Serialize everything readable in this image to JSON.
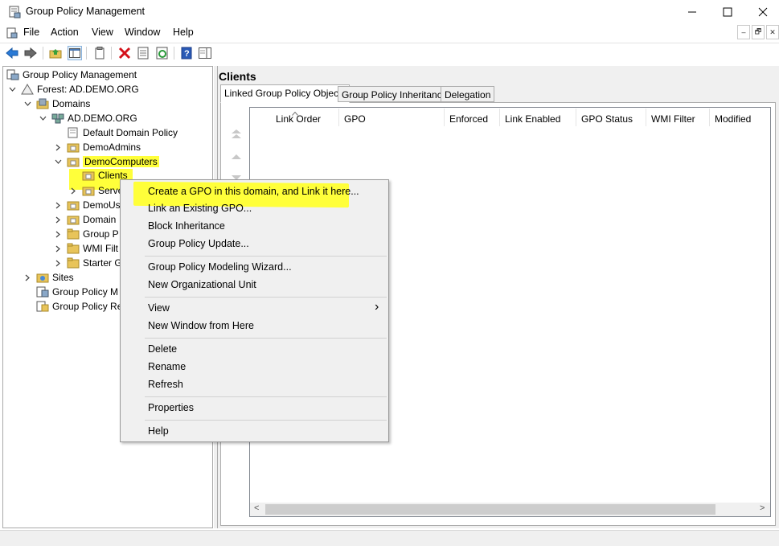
{
  "window": {
    "title": "Group Policy Management",
    "minimize": "—",
    "maximize": "☐",
    "close": "✕"
  },
  "menubar": {
    "items": [
      "File",
      "Action",
      "View",
      "Window",
      "Help"
    ],
    "mdi_min": "–",
    "mdi_restore": "🗗",
    "mdi_close": "✕"
  },
  "tree": {
    "root": "Group Policy Management",
    "forest": "Forest: AD.DEMO.ORG",
    "domains": "Domains",
    "domain": "AD.DEMO.ORG",
    "default_policy": "Default Domain Policy",
    "demoadmins": "DemoAdmins",
    "democomputers": "DemoComputers",
    "clients": "Clients",
    "servers": "Serve",
    "demousers": "DemoUs",
    "domain_controllers": "Domain",
    "group_policy_objects": "Group P",
    "wmi_filters": "WMI Filt",
    "starter_gpos": "Starter G",
    "sites": "Sites",
    "gp_modeling": "Group Policy M",
    "gp_results": "Group Policy Re"
  },
  "details": {
    "title": "Clients",
    "tabs": [
      "Linked Group Policy Objects",
      "Group Policy Inheritance",
      "Delegation"
    ],
    "columns": [
      "Link Order",
      "GPO",
      "Enforced",
      "Link Enabled",
      "GPO Status",
      "WMI Filter",
      "Modified"
    ],
    "scroll_left": "<",
    "scroll_right": ">"
  },
  "context_menu": {
    "create_gpo": "Create a GPO in this domain, and Link it here...",
    "link_existing": "Link an Existing GPO...",
    "block_inheritance": "Block Inheritance",
    "gp_update": "Group Policy Update...",
    "modeling_wizard": "Group Policy Modeling Wizard...",
    "new_ou": "New Organizational Unit",
    "view": "View",
    "view_arrow": "›",
    "new_window": "New Window from Here",
    "delete": "Delete",
    "rename": "Rename",
    "refresh": "Refresh",
    "properties": "Properties",
    "help": "Help"
  },
  "colors": {
    "highlight": "#ffff3a",
    "folder": "#e8c45a",
    "accent": "#1e73c8"
  }
}
